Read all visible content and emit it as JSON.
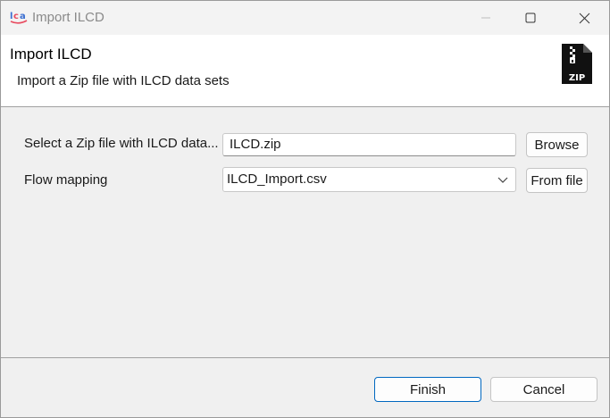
{
  "window": {
    "title": "Import ILCD",
    "logo_text": "LCA"
  },
  "banner": {
    "heading": "Import ILCD",
    "description": "Import a Zip file with ILCD data sets",
    "icon_text": "ZIP"
  },
  "form": {
    "zip_label": "Select a Zip file with ILCD data...",
    "zip_value": "ILCD.zip",
    "browse_label": "Browse",
    "mapping_label": "Flow mapping",
    "mapping_value": "ILCD_Import.csv",
    "from_file_label": "From file"
  },
  "footer": {
    "finish_label": "Finish",
    "cancel_label": "Cancel"
  },
  "colors": {
    "accent": "#0067c0",
    "logo_blue": "#3b6fd1",
    "logo_red": "#e84a5f"
  }
}
